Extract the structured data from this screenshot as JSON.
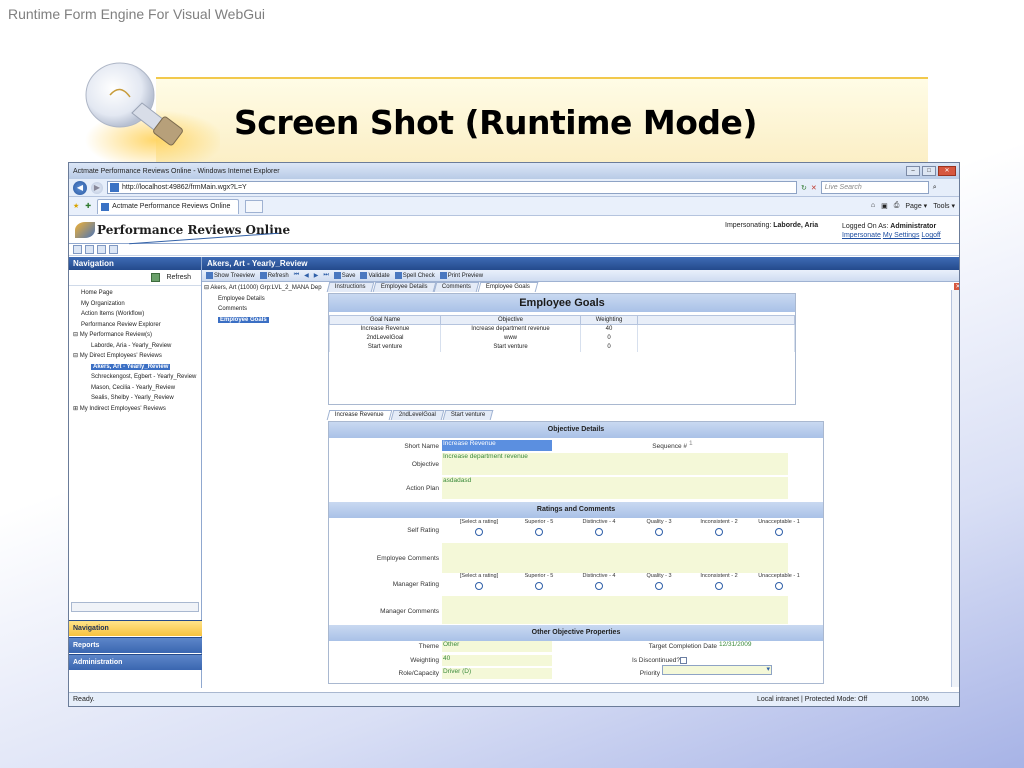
{
  "slide": {
    "header": "Runtime Form Engine For Visual WebGui",
    "title": "Screen Shot (Runtime Mode)"
  },
  "browser": {
    "window_title": "Actmate Performance Reviews Online - Windows Internet Explorer",
    "url": "http://localhost:49862/frmMain.wgx?L=Y",
    "search_placeholder": "Live Search",
    "tab_title": "Actmate Performance Reviews Online",
    "tools": [
      "Page ▾",
      "Tools ▾"
    ]
  },
  "app": {
    "logo": "Performance Reviews Online",
    "impersonating_label": "Impersonating:",
    "impersonating_value": "Laborde, Aria",
    "logged_on_label": "Logged On As:",
    "logged_on_value": "Administrator",
    "links": [
      "Impersonate",
      "My Settings",
      "Logoff"
    ]
  },
  "nav": {
    "title": "Navigation",
    "refresh": "Refresh",
    "tree": [
      "Home Page",
      "My Organization",
      "Action Items (Workflow)",
      "Performance Review Explorer",
      "⊟ My Performance Review(s)",
      "Laborde, Aria - Yearly_Review",
      "⊟ My Direct Employees' Reviews",
      "Akers, Art - Yearly_Review",
      "Schreckengost, Egbert - Yearly_Review",
      "Mason, Cecilia - Yearly_Review",
      "Sealis, Shelby - Yearly_Review",
      "⊞ My Indirect Employees' Reviews"
    ],
    "sections": [
      "Navigation",
      "Reports",
      "Administration"
    ]
  },
  "content": {
    "title": "Akers, Art - Yearly_Review",
    "toolbar": [
      "Show Treeview",
      "Refresh",
      "Save",
      "Validate",
      "Spell Check",
      "Print Preview"
    ],
    "subtree": [
      "⊟ Akers, Art (11000) Grp:LVL_2_MANA Dep",
      "Employee Details",
      "Comments",
      "Employee Goals"
    ],
    "tabs": [
      "Instructions",
      "Employee Details",
      "Comments",
      "Employee Goals"
    ],
    "goals_title": "Employee Goals",
    "goals_headers": [
      "Goal Name",
      "Objective",
      "Weighting"
    ],
    "goals_rows": [
      [
        "Increase Revenue",
        "Increase department revenue",
        "40"
      ],
      [
        "2ndLevelGoal",
        "www",
        "0"
      ],
      [
        "Start venture",
        "Start venture",
        "0"
      ]
    ],
    "objective_tabs": [
      "Increase Revenue",
      "2ndLevelGoal",
      "Start venture"
    ]
  },
  "form": {
    "objective_details": "Objective Details",
    "short_name_label": "Short Name",
    "short_name_value": "Increase Revenue",
    "sequence_label": "Sequence #",
    "sequence_value": "1",
    "objective_label": "Objective",
    "objective_value": "Increase department revenue",
    "action_plan_label": "Action Plan",
    "action_plan_value": "asdadasd",
    "ratings_band": "Ratings and Comments",
    "self_rating_label": "Self Rating",
    "employee_comments_label": "Employee Comments",
    "manager_rating_label": "Manager Rating",
    "manager_comments_label": "Manager Comments",
    "rating_options": [
      "[Select a rating]",
      "Superior - 5",
      "Distinctive - 4",
      "Quality - 3",
      "Inconsistent - 2",
      "Unacceptable - 1"
    ],
    "other_band": "Other Objective Properties",
    "theme_label": "Theme",
    "theme_value": "Other",
    "target_label": "Target Completion Date",
    "target_value": "12/31/2009",
    "weighting_label": "Weighting",
    "weighting_value": "40",
    "discontinued_label": "Is Discontinued?",
    "role_label": "Role/Capacity",
    "role_value": "Driver (D)",
    "priority_label": "Priority"
  },
  "status": {
    "left": "Ready.",
    "zone": "Local intranet | Protected Mode: Off",
    "zoom": "100%"
  }
}
